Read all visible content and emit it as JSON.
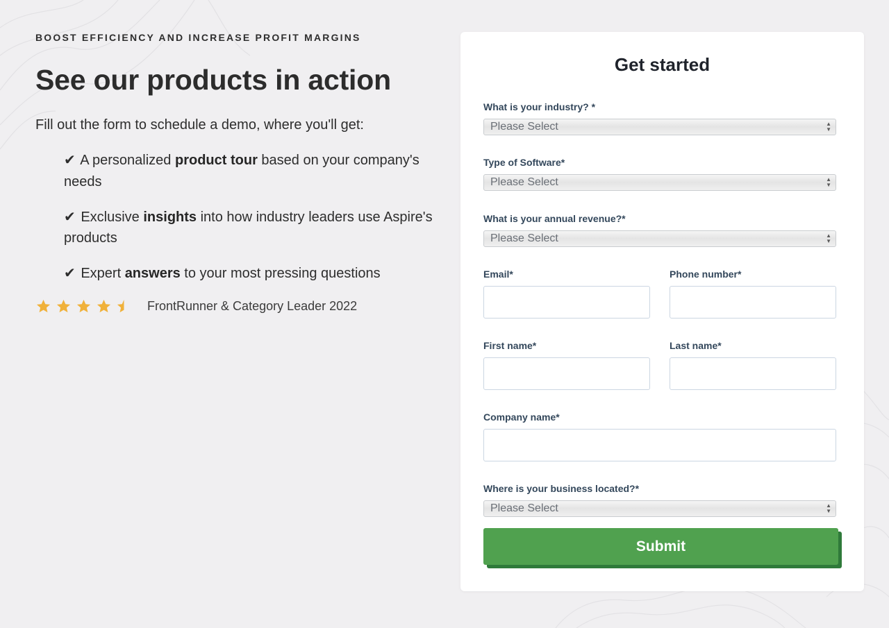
{
  "hero": {
    "eyebrow": "BOOST EFFICIENCY AND INCREASE PROFIT MARGINS",
    "headline": "See our products in action",
    "intro": "Fill out the form to schedule a demo, where you'll get:",
    "check_glyph": "✔",
    "benefits": [
      {
        "before": " A personalized ",
        "bold": "product tour",
        "after": " based on your company's needs"
      },
      {
        "before": " Exclusive ",
        "bold": "insights",
        "after": " into how industry leaders use Aspire's products"
      },
      {
        "before": " Expert ",
        "bold": "answers",
        "after": " to your most pressing questions"
      }
    ],
    "rating": {
      "stars": 4.5,
      "star_color": "#f0b13a",
      "label": "FrontRunner & Category Leader 2022"
    }
  },
  "form": {
    "title": "Get started",
    "industry": {
      "label": "What is your industry? *",
      "value": "Please Select"
    },
    "software": {
      "label": "Type of Software*",
      "value": "Please Select"
    },
    "revenue": {
      "label": "What is your annual revenue?*",
      "value": "Please Select"
    },
    "email": {
      "label": "Email*",
      "value": ""
    },
    "phone": {
      "label": "Phone number*",
      "value": ""
    },
    "first_name": {
      "label": "First name*",
      "value": ""
    },
    "last_name": {
      "label": "Last name*",
      "value": ""
    },
    "company": {
      "label": "Company name*",
      "value": ""
    },
    "location": {
      "label": "Where is your business located?*",
      "value": "Please Select"
    },
    "submit_label": "Submit",
    "submit_color": "#50a14f"
  }
}
